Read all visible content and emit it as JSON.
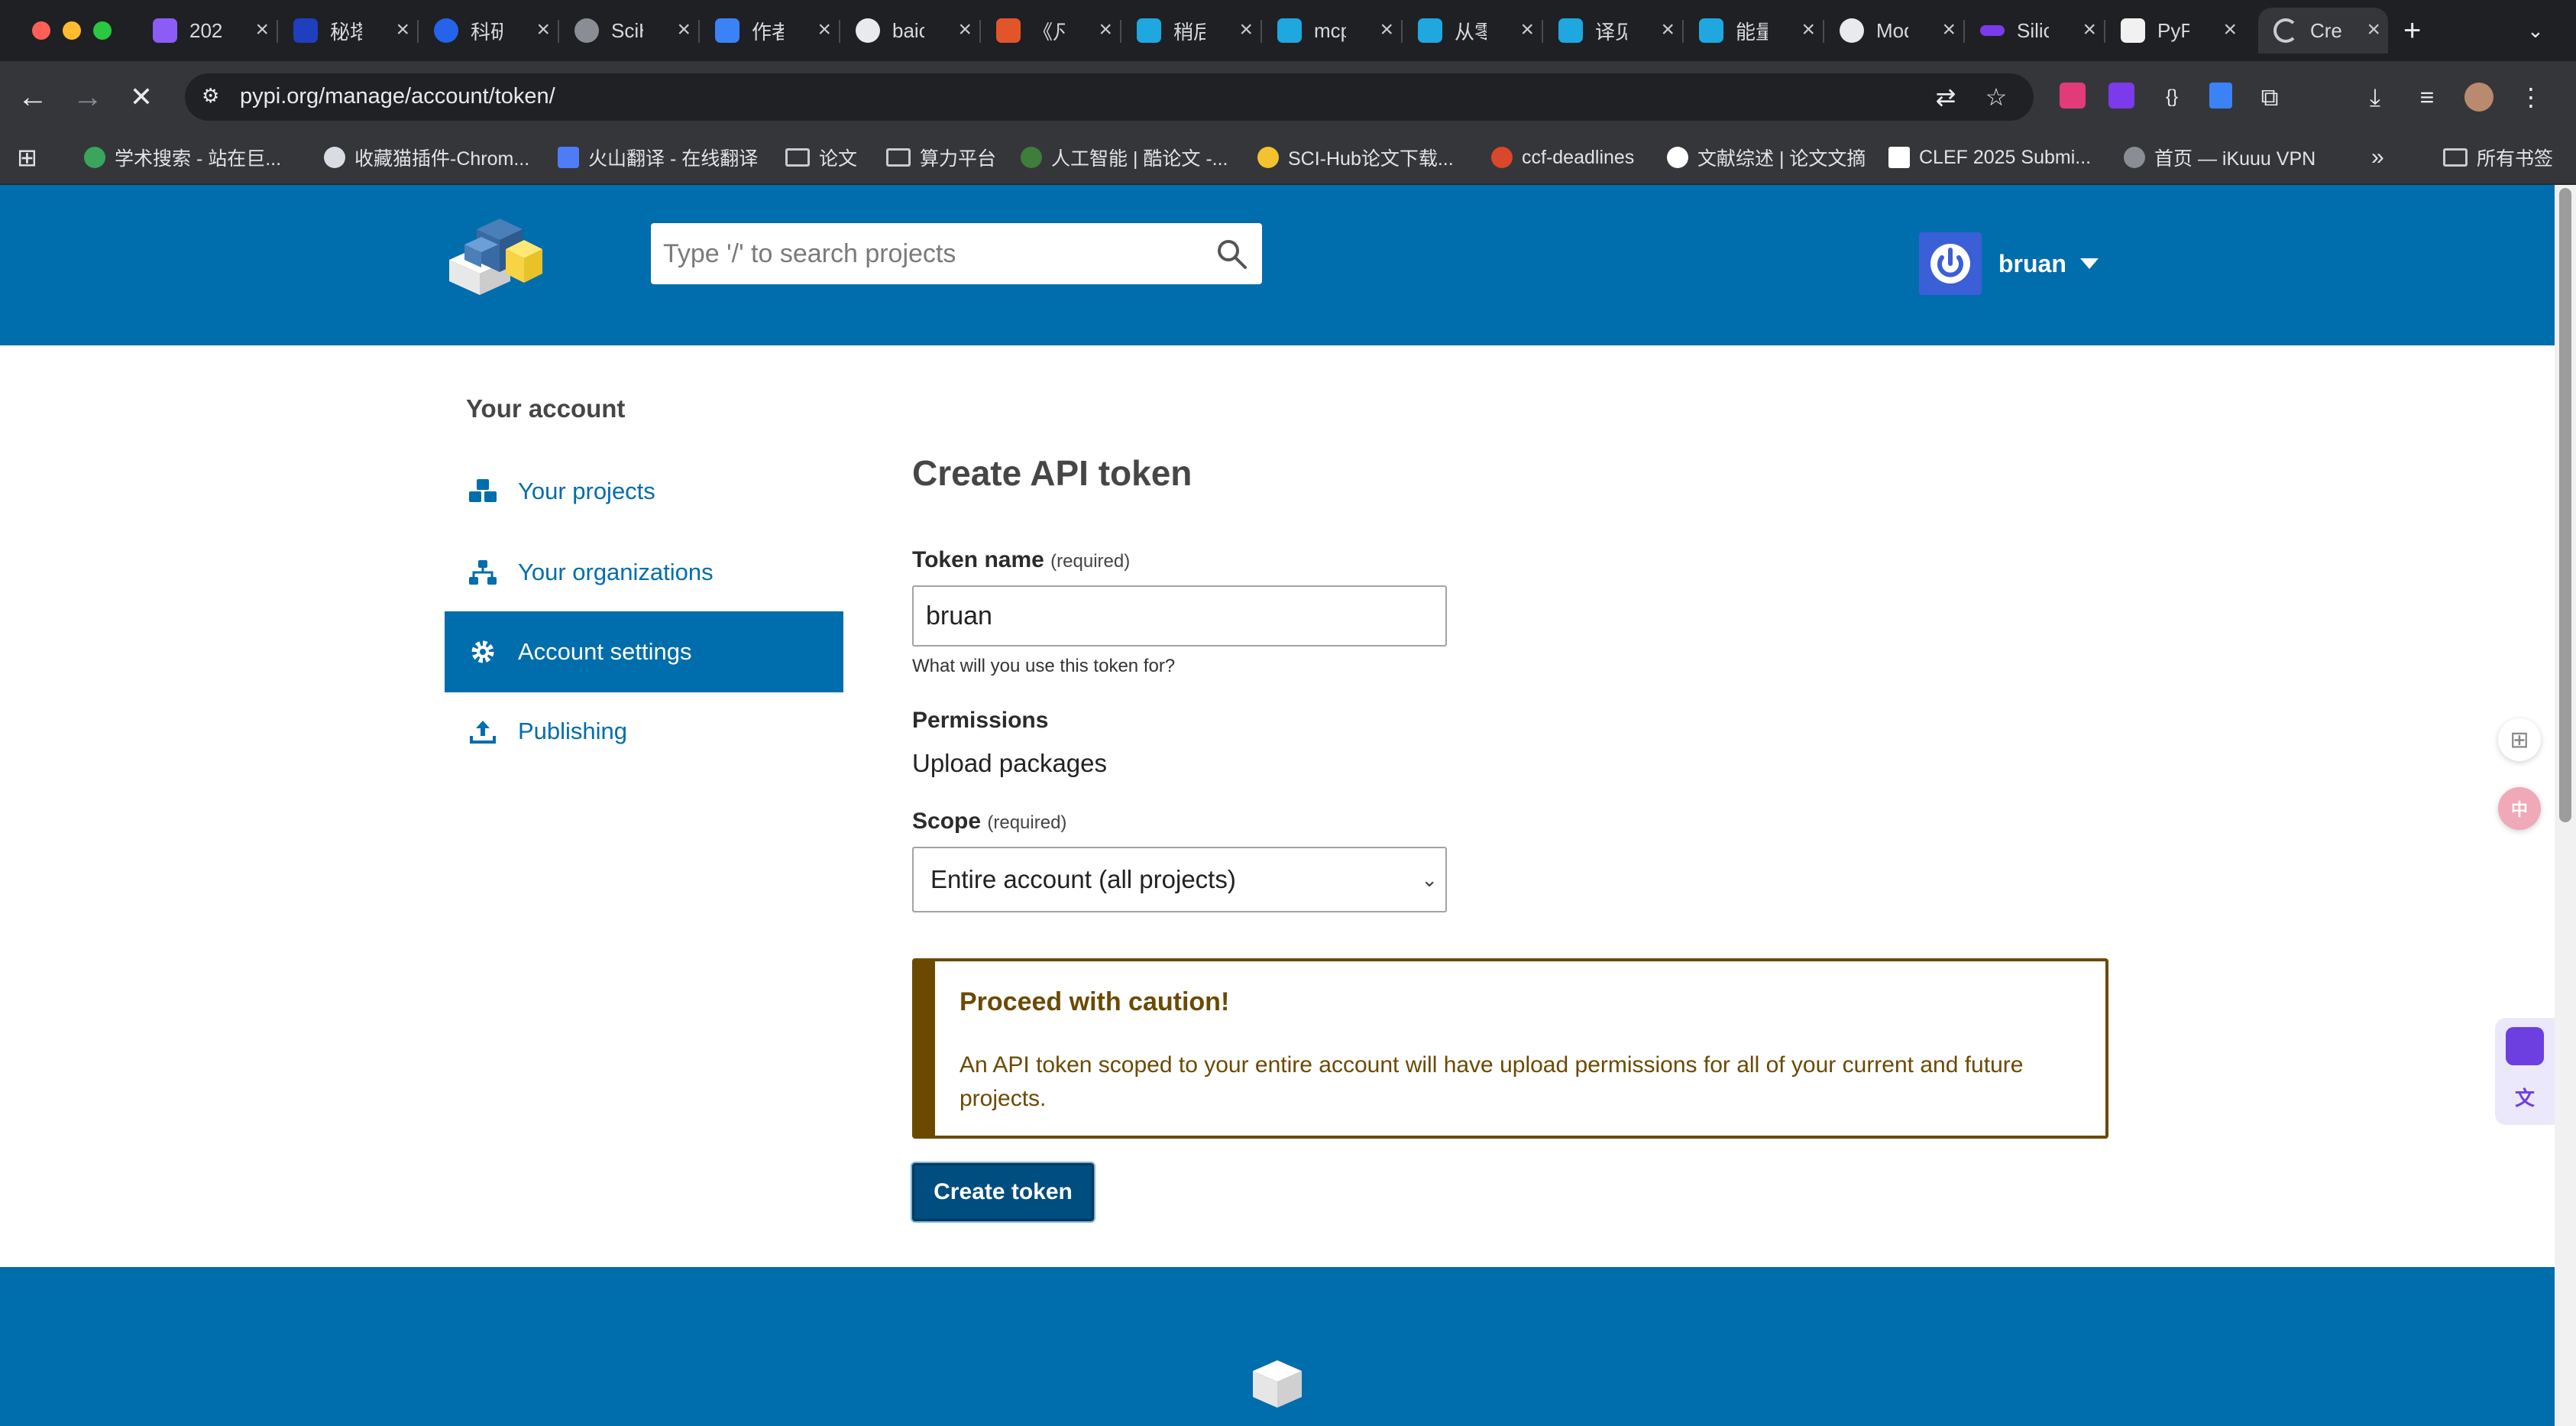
{
  "browser": {
    "tabs": [
      {
        "label": "202"
      },
      {
        "label": "秘塔"
      },
      {
        "label": "科研"
      },
      {
        "label": "SciH"
      },
      {
        "label": "作者"
      },
      {
        "label": "baic"
      },
      {
        "label": "《凡"
      },
      {
        "label": "稍后"
      },
      {
        "label": "mcp"
      },
      {
        "label": "从零"
      },
      {
        "label": "译见"
      },
      {
        "label": "能量"
      },
      {
        "label": "Mod"
      },
      {
        "label": "Silic"
      },
      {
        "label": "PyP"
      },
      {
        "label": "Crea"
      }
    ],
    "url": "pypi.org/manage/account/token/",
    "bookmarks": [
      "学术搜索 - 站在巨...",
      "收藏猫插件-Chrom...",
      "火山翻译 - 在线翻译",
      "论文",
      "算力平台",
      "人工智能 | 酷论文 -...",
      "SCI-Hub论文下载...",
      "ccf-deadlines",
      "文献综述 | 论文文摘",
      "CLEF 2025 Submi...",
      "首页 — iKuuu VPN"
    ],
    "all_bookmarks": "所有书签"
  },
  "header": {
    "search_placeholder": "Type '/' to search projects",
    "username": "bruan"
  },
  "sidebar": {
    "title": "Your account",
    "items": [
      {
        "label": "Your projects"
      },
      {
        "label": "Your organizations"
      },
      {
        "label": "Account settings"
      },
      {
        "label": "Publishing"
      }
    ]
  },
  "form": {
    "title": "Create API token",
    "token_label": "Token name",
    "required": "(required)",
    "token_value": "bruan",
    "token_help": "What will you use this token for?",
    "permissions_label": "Permissions",
    "permissions_value": "Upload packages",
    "scope_label": "Scope",
    "scope_value": "Entire account (all projects)",
    "caution_title": "Proceed with caution!",
    "caution_body": "An API token scoped to your entire account will have upload permissions for all of your current and future projects.",
    "submit_label": "Create token"
  }
}
